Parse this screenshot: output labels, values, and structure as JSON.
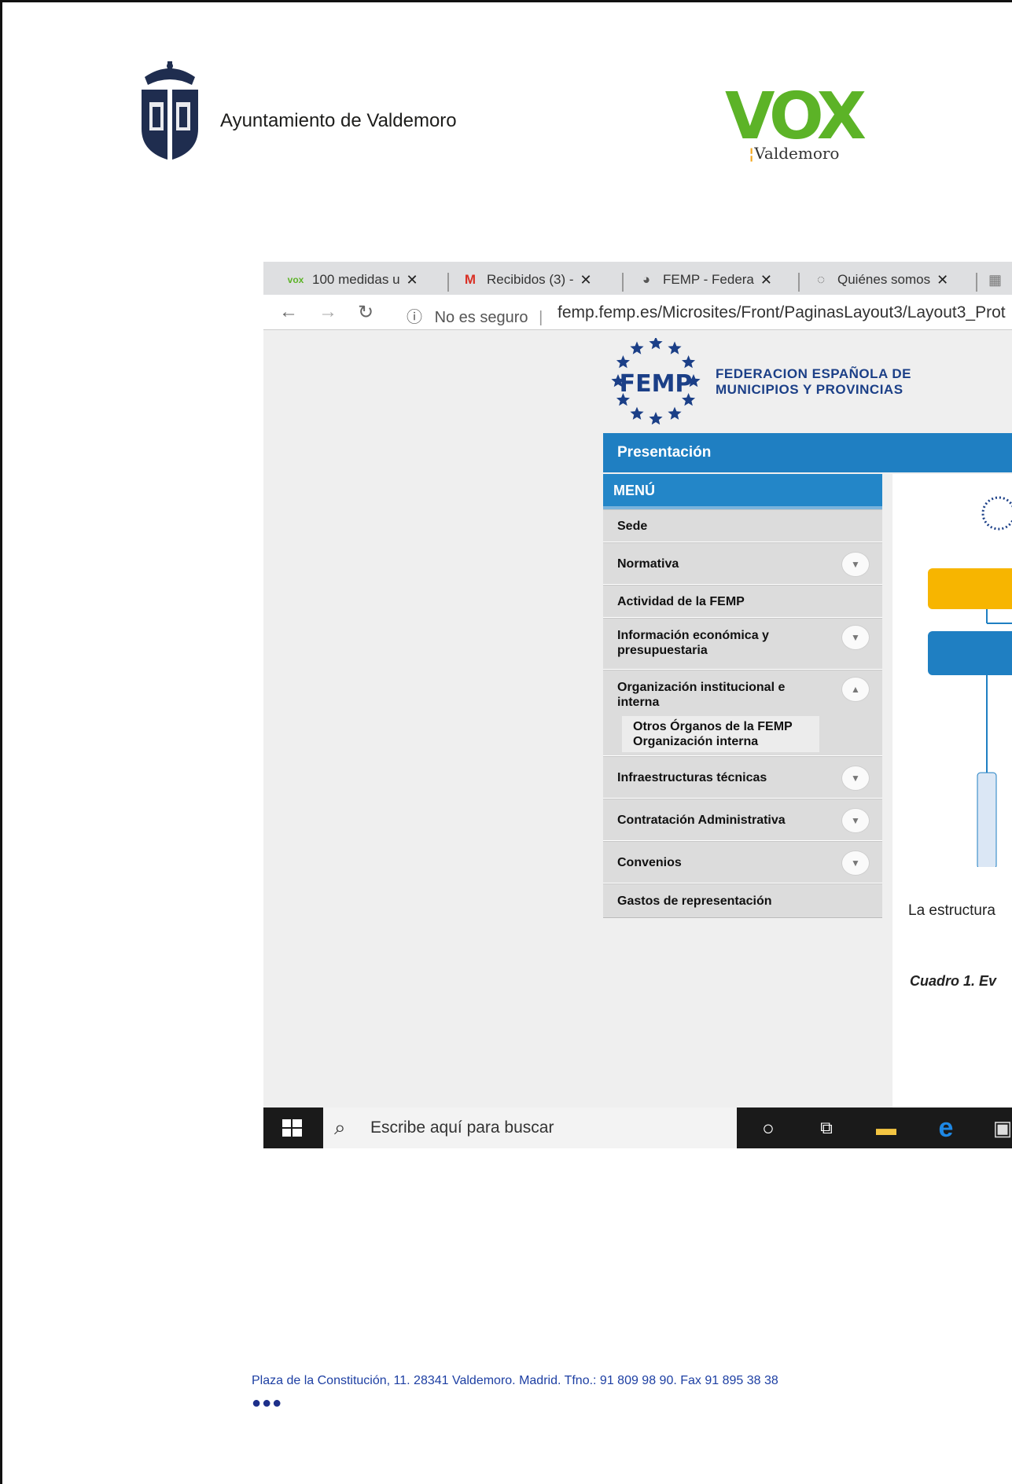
{
  "letterhead": {
    "ayuntamiento": "Ayuntamiento de Valdemoro",
    "vox_logo": "VOX",
    "vox_sub": "Valdemoro",
    "vox_green": "#5cb327"
  },
  "browser": {
    "tabs": [
      {
        "icon": "vox",
        "label": "100 medidas u",
        "close": "✕"
      },
      {
        "icon": "M",
        "label": "Recibidos (3) -",
        "close": "✕"
      },
      {
        "icon": "◕",
        "label": "FEMP - Federa",
        "close": "✕"
      },
      {
        "icon": "◌",
        "label": "Quiénes somos",
        "close": "✕"
      }
    ],
    "security": "No es seguro",
    "url": "femp.femp.es/Microsites/Front/PaginasLayout3/Layout3_Prot"
  },
  "femp": {
    "logo_text": "FEMP",
    "title_line1": "FEDERACION ESPAÑOLA DE",
    "title_line2": "MUNICIPIOS  Y  PROVINCIAS",
    "presentacion": "Presentación",
    "menu_title": "MENÚ",
    "menu_items": [
      {
        "label": "Sede"
      },
      {
        "label": "Normativa"
      },
      {
        "label": "Actividad de la FEMP"
      },
      {
        "label": "Información económica y presupuestaria"
      },
      {
        "label": "Organización institucional e interna"
      },
      {
        "label": "Infraestructuras técnicas"
      },
      {
        "label": "Contratación Administrativa"
      },
      {
        "label": "Convenios"
      },
      {
        "label": "Gastos de representación"
      }
    ],
    "submenu": [
      "Otros Órganos de la FEMP",
      "Organización interna"
    ],
    "estructura_text": "La estructura",
    "cuadro_text": "Cuadro 1. Ev",
    "blue": "#1f7fc2"
  },
  "taskbar": {
    "search_placeholder": "Escribe aquí para buscar"
  },
  "footer": {
    "address": "Plaza de la Constitución, 11. 28341 Valdemoro. Madrid. Tfno.: 91 809 98 90. Fax 91 895 38 38",
    "dots": "●●●"
  }
}
